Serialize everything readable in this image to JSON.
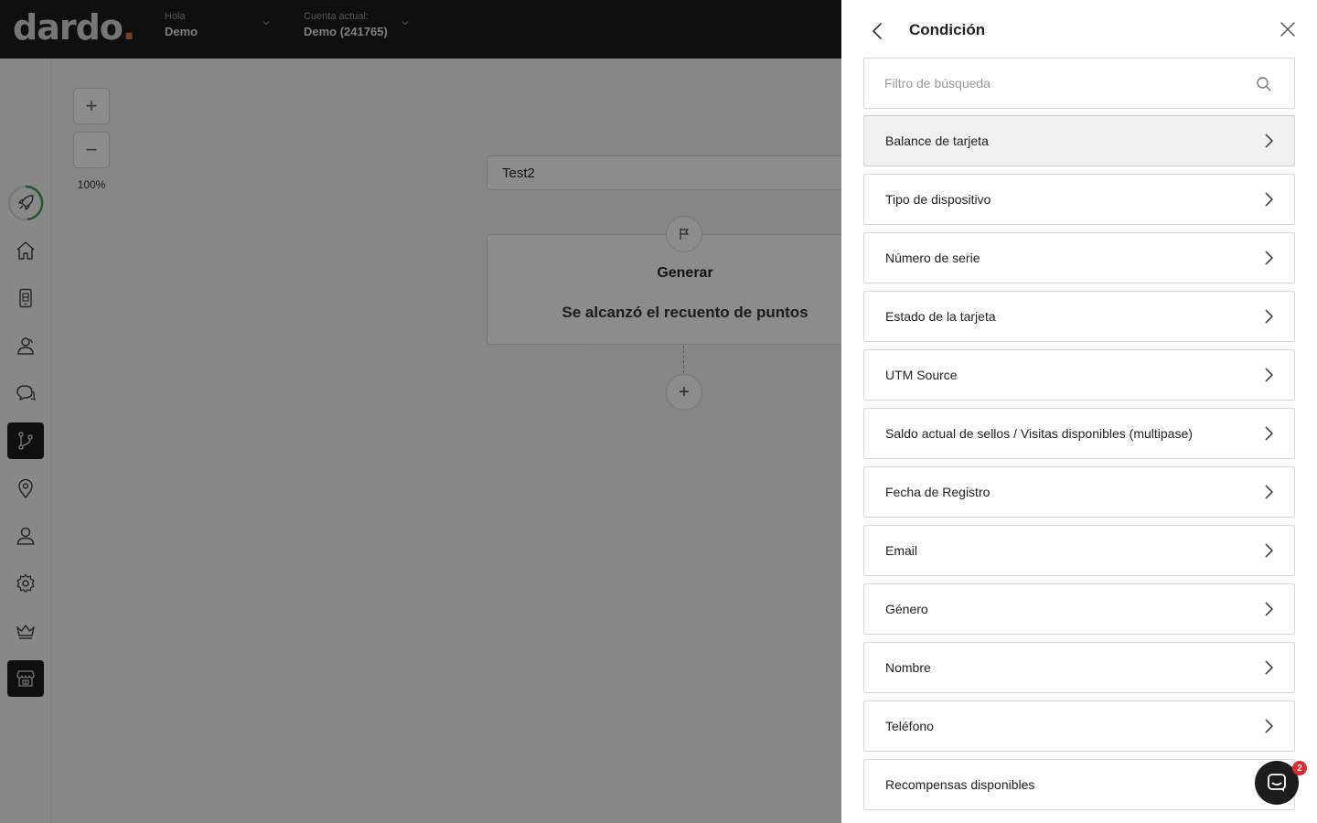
{
  "header": {
    "logo": "dardo",
    "logo_dot": ".",
    "greeting_label": "Hola",
    "greeting_name": "Demo",
    "account_label": "Cuenta actual:",
    "account_name": "Demo (241765)"
  },
  "sidebar": {
    "items": [
      {
        "name": "rocket",
        "active": false
      },
      {
        "name": "home",
        "active": false
      },
      {
        "name": "mobile-card",
        "active": false
      },
      {
        "name": "customers",
        "active": false
      },
      {
        "name": "chat",
        "active": false
      },
      {
        "name": "flows",
        "active": true
      },
      {
        "name": "location",
        "active": false
      },
      {
        "name": "user",
        "active": false
      },
      {
        "name": "settings",
        "active": false
      },
      {
        "name": "crown",
        "active": false
      },
      {
        "name": "store",
        "active": true
      }
    ]
  },
  "canvas": {
    "zoom_in": "+",
    "zoom_out": "−",
    "zoom_level": "100%",
    "flow_name": "Test2",
    "trigger_title": "Generar",
    "trigger_subtitle": "Se alcanzó el recuento de puntos",
    "add_step": "+"
  },
  "drawer": {
    "title": "Condición",
    "search_placeholder": "Filtro de búsqueda",
    "items": [
      "Balance de tarjeta",
      "Tipo de dispositivo",
      "Número de serie",
      "Estado de la tarjeta",
      "UTM Source",
      "Saldo actual de sellos / Visitas disponibles (multipase)",
      "Fecha de Registro",
      "Email",
      "Género",
      "Nombre",
      "Teléfono",
      "Recompensas disponibles"
    ]
  },
  "chat": {
    "badge_count": "2"
  },
  "colors": {
    "dark": "#1c1c1c",
    "accent": "#e8792a",
    "badge": "#e0282e",
    "progress": "#3aa35a"
  }
}
